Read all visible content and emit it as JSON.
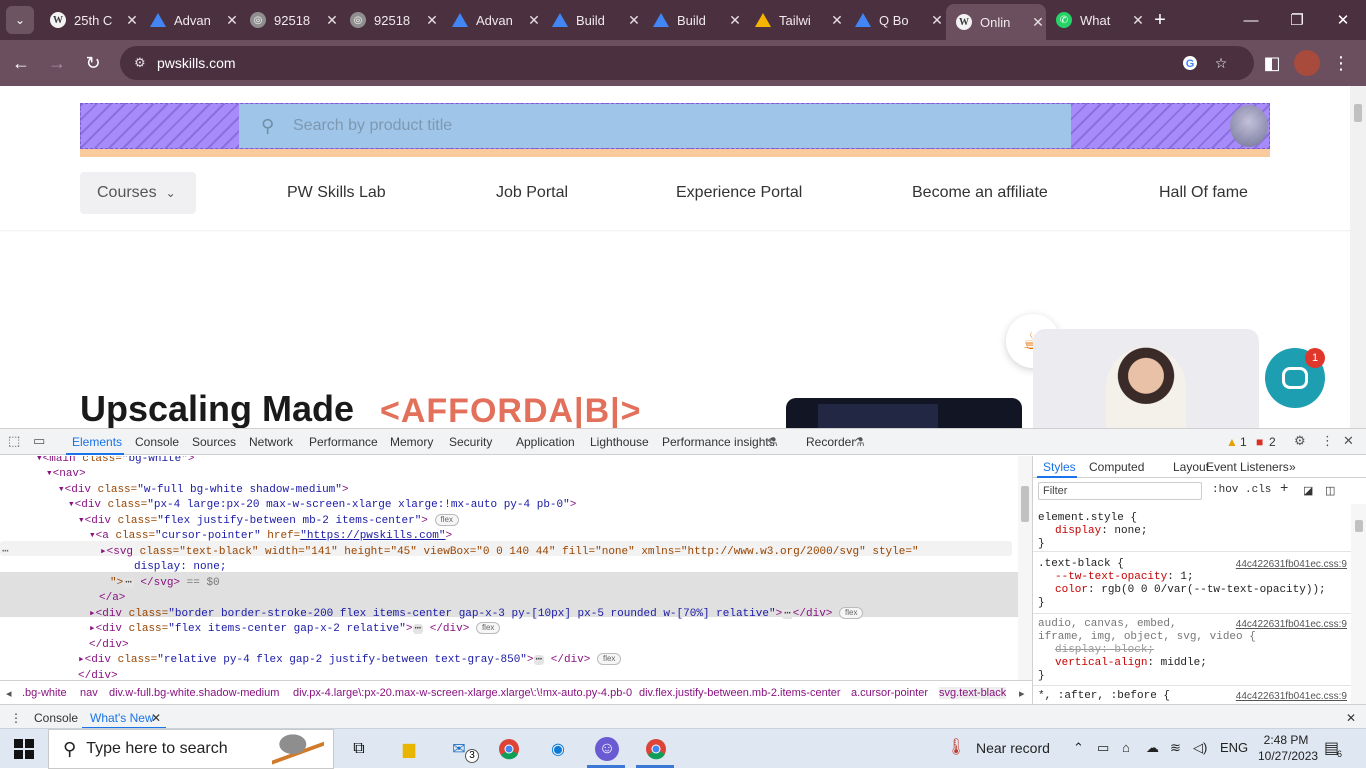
{
  "browser": {
    "tabs": [
      {
        "title": "25th C",
        "icon": "wordpress-icon"
      },
      {
        "title": "Advan",
        "icon": "google-drive-icon"
      },
      {
        "title": "92518",
        "icon": "globe-icon"
      },
      {
        "title": "92518",
        "icon": "globe-icon"
      },
      {
        "title": "Advan",
        "icon": "google-drive-icon"
      },
      {
        "title": "Build",
        "icon": "google-drive-icon"
      },
      {
        "title": "Build",
        "icon": "google-drive-icon"
      },
      {
        "title": "Tailwi",
        "icon": "google-drive-icon"
      },
      {
        "title": "Q Bo",
        "icon": "q-icon"
      },
      {
        "title": "Onlin",
        "icon": "wordpress-icon",
        "active": true
      },
      {
        "title": "What",
        "icon": "whatsapp-icon"
      }
    ],
    "url": "pwskills.com"
  },
  "site": {
    "search_placeholder": "Search by product title",
    "nav": {
      "courses": "Courses",
      "links": [
        "PW Skills Lab",
        "Job Portal",
        "Experience Portal",
        "Become an affiliate",
        "Hall Of fame"
      ]
    },
    "hero": {
      "title": "Upscaling Made",
      "accent": "<AFFORDA|B|>"
    },
    "chat_badge": "1"
  },
  "devtools": {
    "tabs": [
      "Elements",
      "Console",
      "Sources",
      "Network",
      "Performance",
      "Memory",
      "Security",
      "Application",
      "Lighthouse",
      "Performance insights",
      "Recorder"
    ],
    "warnings": "1",
    "errors": "2",
    "dom": {
      "l1_tag": "<main ",
      "l1_attr": "class=",
      "l1_val": "\"bg-white\"",
      "l1_end": ">",
      "l2": "<nav>",
      "l3_tag": "<div ",
      "l3_attr": "class=",
      "l3_val": "\"w-full bg-white shadow-medium\"",
      "l3_end": ">",
      "l4_tag": "<div ",
      "l4_attr": "class=",
      "l4_val": "\"px-4 large:px-20 max-w-screen-xlarge xlarge:!mx-auto py-4 pb-0\"",
      "l4_end": ">",
      "l5_tag": "<div ",
      "l5_attr": "class=",
      "l5_val": "\"flex justify-between mb-2 items-center\"",
      "l5_end": ">",
      "l6_tag": "<a ",
      "l6_attr1": "class=",
      "l6_val1": "\"cursor-pointer\"",
      "l6_attr2": " href=",
      "l6_val2": "\"https://pwskills.com\"",
      "l6_end": ">",
      "l7_tag": "<svg ",
      "l7_attrs": "class=\"text-black\" width=\"141\" height=\"45\" viewBox=\"0 0 140 44\" fill=\"none\" xmlns=\"http://www.w3.org/2000/svg\" style=\"",
      "l8": "display: none;",
      "l9_a": "\">",
      "l9_b": " </svg>",
      "l9_c": " == $0",
      "l10": "</a>",
      "l11_tag": "<div ",
      "l11_attr": "class=",
      "l11_val": "\"border border-stroke-200 flex items-center gap-x-3 py-[10px] px-5 rounded w-[70%] relative\"",
      "l11_end": ">",
      "l11_close": "</div>",
      "l12_tag": "<div ",
      "l12_attr": "class=",
      "l12_val": "\"flex items-center gap-x-2 relative\"",
      "l12_end": ">",
      "l12_close": " </div>",
      "l13": "</div>",
      "l14_tag": "<div ",
      "l14_attr": "class=",
      "l14_val": "\"relative py-4 flex gap-2 justify-between text-gray-850\"",
      "l14_end": ">",
      "l14_close": " </div>",
      "l15": "</div>",
      "flex_badge": "flex",
      "dots": "⋯"
    },
    "breadcrumbs": [
      ".bg-white",
      "nav",
      "div.w-full.bg-white.shadow-medium",
      "div.px-4.large\\:px-20.max-w-screen-xlarge.xlarge\\:\\!mx-auto.py-4.pb-0",
      "div.flex.justify-between.mb-2.items-center",
      "a.cursor-pointer",
      "svg.text-black"
    ],
    "styles": {
      "tabs": [
        "Styles",
        "Computed",
        "Layout",
        "Event Listeners"
      ],
      "filter_placeholder": "Filter",
      "hov": ":hov",
      "cls": ".cls",
      "r1_sel": "element.style {",
      "r1_p": "display",
      "r1_v": ": none;",
      "close": "}",
      "r2_sel": ".text-black {",
      "r2_link": "44c422631fb041ec.css:9",
      "r2_p1": "--tw-text-opacity",
      "r2_v1": ": 1;",
      "r2_p2": "color",
      "r2_v2": ": rgb(0 0 0/var(--tw-text-opacity));",
      "r3_sel1": "audio, canvas, embed,",
      "r3_sel2": "iframe, img, object, svg, video {",
      "r3_link": "44c422631fb041ec.css:9",
      "r3_p1": "display: block;",
      "r3_p2": "vertical-align",
      "r3_v2": ": middle;",
      "r4_sel": "*, :after, :before {",
      "r4_link": "44c422631fb041ec.css:9"
    },
    "drawer": [
      "Console",
      "What's New"
    ]
  },
  "taskbar": {
    "search_placeholder": "Type here to search",
    "mail_badge": "3",
    "weather": "Near record",
    "lang": "ENG",
    "time": "2:48 PM",
    "date": "10/27/2023",
    "notif": "6"
  }
}
